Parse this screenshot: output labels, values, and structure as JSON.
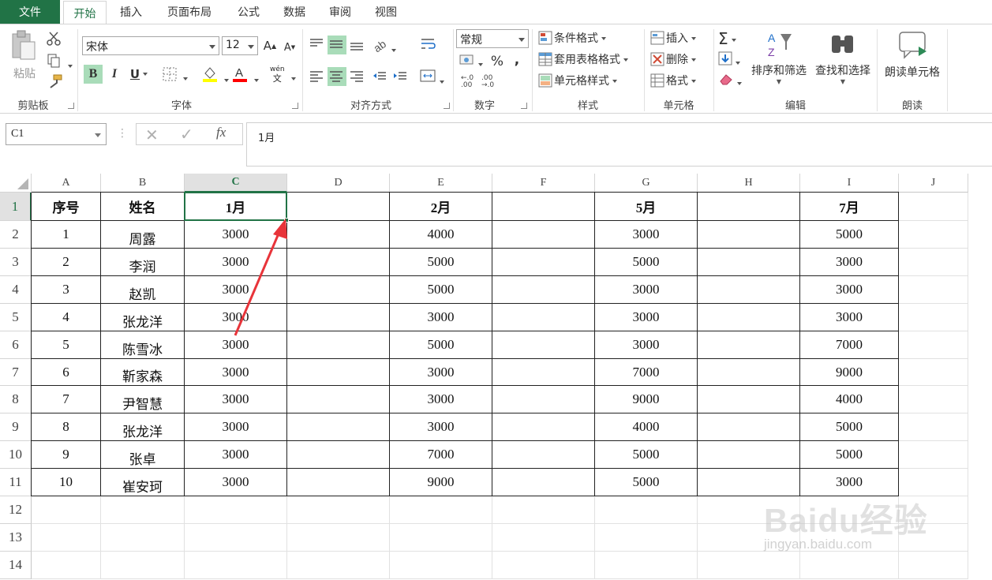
{
  "tabs": {
    "file": "文件",
    "items": [
      "开始",
      "插入",
      "页面布局",
      "公式",
      "数据",
      "审阅",
      "视图"
    ]
  },
  "ribbon": {
    "clipboard": {
      "paste": "粘贴",
      "label": "剪贴板"
    },
    "font": {
      "name": "宋体",
      "size": "12",
      "bold": "B",
      "italic": "I",
      "underline": "U",
      "grow": "A",
      "shrink": "A",
      "phonetic_top": "wén",
      "phonetic_bottom": "文",
      "label": "字体",
      "font_color": "#ff0000",
      "fill_color": "#ffff00"
    },
    "alignment": {
      "label": "对齐方式"
    },
    "number": {
      "format": "常规",
      "percent": "%",
      "comma": ",",
      "inc_decimal": ".0 .00",
      "dec_decimal": ".00 →.0",
      "label": "数字"
    },
    "styles": {
      "conditional": "条件格式",
      "table": "套用表格格式",
      "cell": "单元格样式",
      "label": "样式"
    },
    "cells": {
      "insert": "插入",
      "delete": "删除",
      "format": "格式",
      "label": "单元格"
    },
    "editing": {
      "sort": "排序和筛选",
      "find": "查找和选择",
      "label": "编辑"
    },
    "read": {
      "read_cell": "朗读单元格",
      "label": "朗读"
    }
  },
  "formula_bar": {
    "name_box": "C1",
    "fx": "fx",
    "content": "1月"
  },
  "columns": [
    "A",
    "B",
    "C",
    "D",
    "E",
    "F",
    "G",
    "H",
    "I",
    "J"
  ],
  "rows": [
    "1",
    "2",
    "3",
    "4",
    "5",
    "6",
    "7",
    "8",
    "9",
    "10",
    "11",
    "12",
    "13",
    "14"
  ],
  "selected_cell": "C1",
  "table": {
    "headers": {
      "A": "序号",
      "B": "姓名",
      "C": "1月",
      "E": "2月",
      "G": "5月",
      "I": "7月"
    },
    "records": [
      {
        "A": "1",
        "B": "周露",
        "C": "3000",
        "E": "4000",
        "G": "3000",
        "I": "5000"
      },
      {
        "A": "2",
        "B": "李润",
        "C": "3000",
        "E": "5000",
        "G": "5000",
        "I": "3000"
      },
      {
        "A": "3",
        "B": "赵凯",
        "C": "3000",
        "E": "5000",
        "G": "3000",
        "I": "3000"
      },
      {
        "A": "4",
        "B": "张龙洋",
        "C": "3000",
        "E": "3000",
        "G": "3000",
        "I": "3000"
      },
      {
        "A": "5",
        "B": "陈雪冰",
        "C": "3000",
        "E": "5000",
        "G": "3000",
        "I": "7000"
      },
      {
        "A": "6",
        "B": "靳家森",
        "C": "3000",
        "E": "3000",
        "G": "7000",
        "I": "9000"
      },
      {
        "A": "7",
        "B": "尹智慧",
        "C": "3000",
        "E": "3000",
        "G": "9000",
        "I": "4000"
      },
      {
        "A": "8",
        "B": "张龙洋",
        "C": "3000",
        "E": "3000",
        "G": "4000",
        "I": "5000"
      },
      {
        "A": "9",
        "B": "张卓",
        "C": "3000",
        "E": "7000",
        "G": "5000",
        "I": "5000"
      },
      {
        "A": "10",
        "B": "崔安珂",
        "C": "3000",
        "E": "9000",
        "G": "5000",
        "I": "3000"
      }
    ]
  },
  "watermark": {
    "brand": "Baidu经验",
    "url": "jingyan.baidu.com"
  },
  "colors": {
    "accent": "#217346",
    "arrow": "#e8343a"
  }
}
